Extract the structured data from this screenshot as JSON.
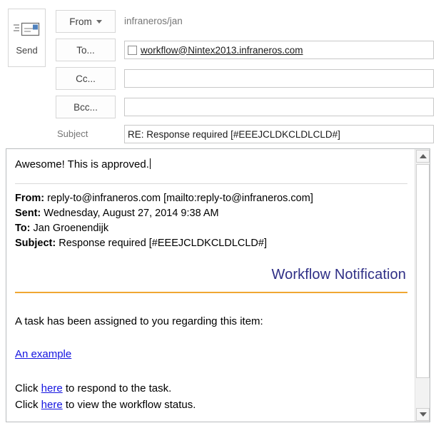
{
  "compose": {
    "send_label": "Send",
    "send_icon": "envelope-send-icon",
    "from_button_label": "From",
    "to_button_label": "To...",
    "cc_button_label": "Cc...",
    "bcc_button_label": "Bcc...",
    "from_value": "infraneros/jan",
    "to_value": "workflow@Nintex2013.infraneros.com",
    "cc_value": "",
    "bcc_value": "",
    "subject_label": "Subject",
    "subject_value": "RE: Response required [#EEEJCLDKCLDLCLD#]"
  },
  "body": {
    "reply_text": "Awesome! This is approved.",
    "quoted": {
      "from_label": "From:",
      "from_value": "reply-to@infraneros.com [mailto:reply-to@infraneros.com]",
      "sent_label": "Sent:",
      "sent_value": "Wednesday, August 27, 2014 9:38 AM",
      "to_label": "To:",
      "to_value": "Jan Groenendijk",
      "subject_label": "Subject:",
      "subject_value": "Response required [#EEEJCLDKCLDLCLD#]"
    },
    "notification": {
      "title": "Workflow Notification",
      "intro": "A task has been assigned to you regarding this item:",
      "item_link": "An example",
      "respond_prefix": "Click ",
      "respond_link": "here",
      "respond_suffix": " to respond to the task.",
      "status_prefix": "Click ",
      "status_link": "here",
      "status_suffix": " to view the workflow status."
    }
  },
  "colors": {
    "title_blue": "#2f2f86",
    "rule_orange": "#f0a732",
    "link_blue": "#1414e0",
    "accent_blue": "#4e81bd"
  }
}
